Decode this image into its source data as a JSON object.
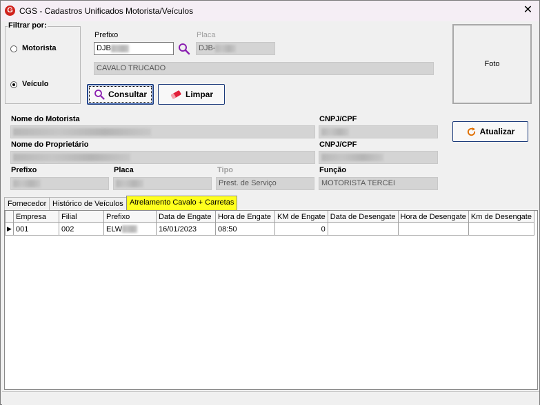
{
  "window": {
    "title": "CGS - Cadastros Unificados Motorista/Veículos",
    "close_glyph": "✕",
    "logo_letter": "G"
  },
  "filter": {
    "legend": "Filtrar por:",
    "options": [
      {
        "label": "Motorista",
        "checked": false
      },
      {
        "label": "Veículo",
        "checked": true
      }
    ]
  },
  "search": {
    "prefixo_label": "Prefixo",
    "prefixo_value": "DJB",
    "placa_label": "Placa",
    "placa_value": "DJB-",
    "vehicle_description": "CAVALO TRUCADO"
  },
  "buttons": {
    "consultar": "Consultar",
    "limpar": "Limpar",
    "atualizar": "Atualizar"
  },
  "photo_label": "Foto",
  "details": {
    "nome_motorista_label": "Nome do Motorista",
    "cnpj_cpf_label_1": "CNPJ/CPF",
    "nome_proprietario_label": "Nome do Proprietário",
    "cnpj_cpf_label_2": "CNPJ/CPF",
    "prefixo_label": "Prefixo",
    "placa_label": "Placa",
    "tipo_label": "Tipo",
    "tipo_value": "Prest. de Serviço",
    "funcao_label": "Função",
    "funcao_value": "MOTORISTA TERCEI"
  },
  "tabs": [
    {
      "label": "Fornecedor",
      "active": false
    },
    {
      "label": "Histórico de Veículos",
      "active": false
    },
    {
      "label": "Atrelamento Cavalo + Carretas",
      "active": true
    }
  ],
  "grid": {
    "columns": [
      "Empresa",
      "Filial",
      "Prefixo",
      "Data de Engate",
      "Hora de Engate",
      "KM de Engate",
      "Data de Desengate",
      "Hora de Desengate",
      "Km de Desengate"
    ],
    "rows": [
      {
        "indicator": "▶",
        "empresa": "001",
        "filial": "002",
        "prefixo": "ELW",
        "data_engate": "16/01/2023",
        "hora_engate": "08:50",
        "km_engate": "0",
        "data_desengate": "",
        "hora_desengate": "",
        "km_desengate": ""
      }
    ]
  },
  "colors": {
    "active_tab": "#ffff1e",
    "button_border": "#1b3a7a",
    "logo": "#d0201c"
  }
}
